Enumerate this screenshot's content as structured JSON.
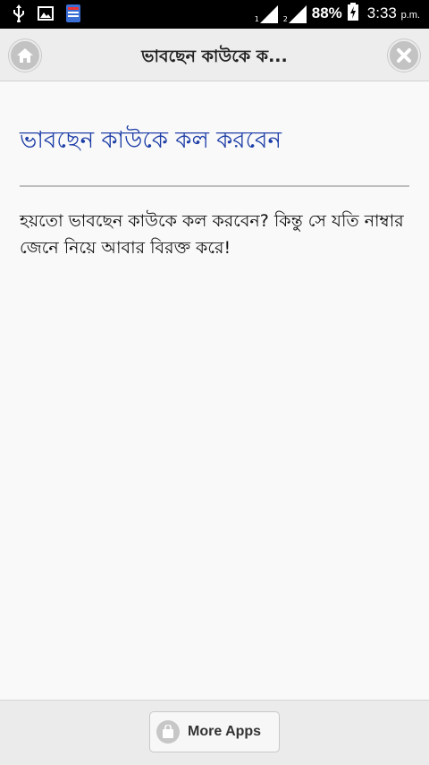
{
  "status_bar": {
    "sim1": "1",
    "sim2": "2",
    "battery": "88%",
    "time": "3:33",
    "time_suffix": "p.m."
  },
  "header": {
    "title": "ভাবছেন কাউকে ক..."
  },
  "content": {
    "heading": "ভাবছেন কাউকে কল করবেন",
    "body": "হয়তো ভাবছেন কাউকে কল করবেন? কিন্তু সে যতি নাম্বার জেনে নিয়ে আবার বিরক্ত করে!"
  },
  "footer": {
    "more_apps": "More Apps"
  },
  "colors": {
    "heading": "#1f3fa8",
    "status_bar": "#000000",
    "header_bg": "#ededed"
  },
  "icons": [
    "usb-icon",
    "image-icon",
    "app-notification-icon",
    "signal-icon",
    "battery-charging-icon",
    "home-icon",
    "close-icon",
    "shopping-bag-icon"
  ]
}
